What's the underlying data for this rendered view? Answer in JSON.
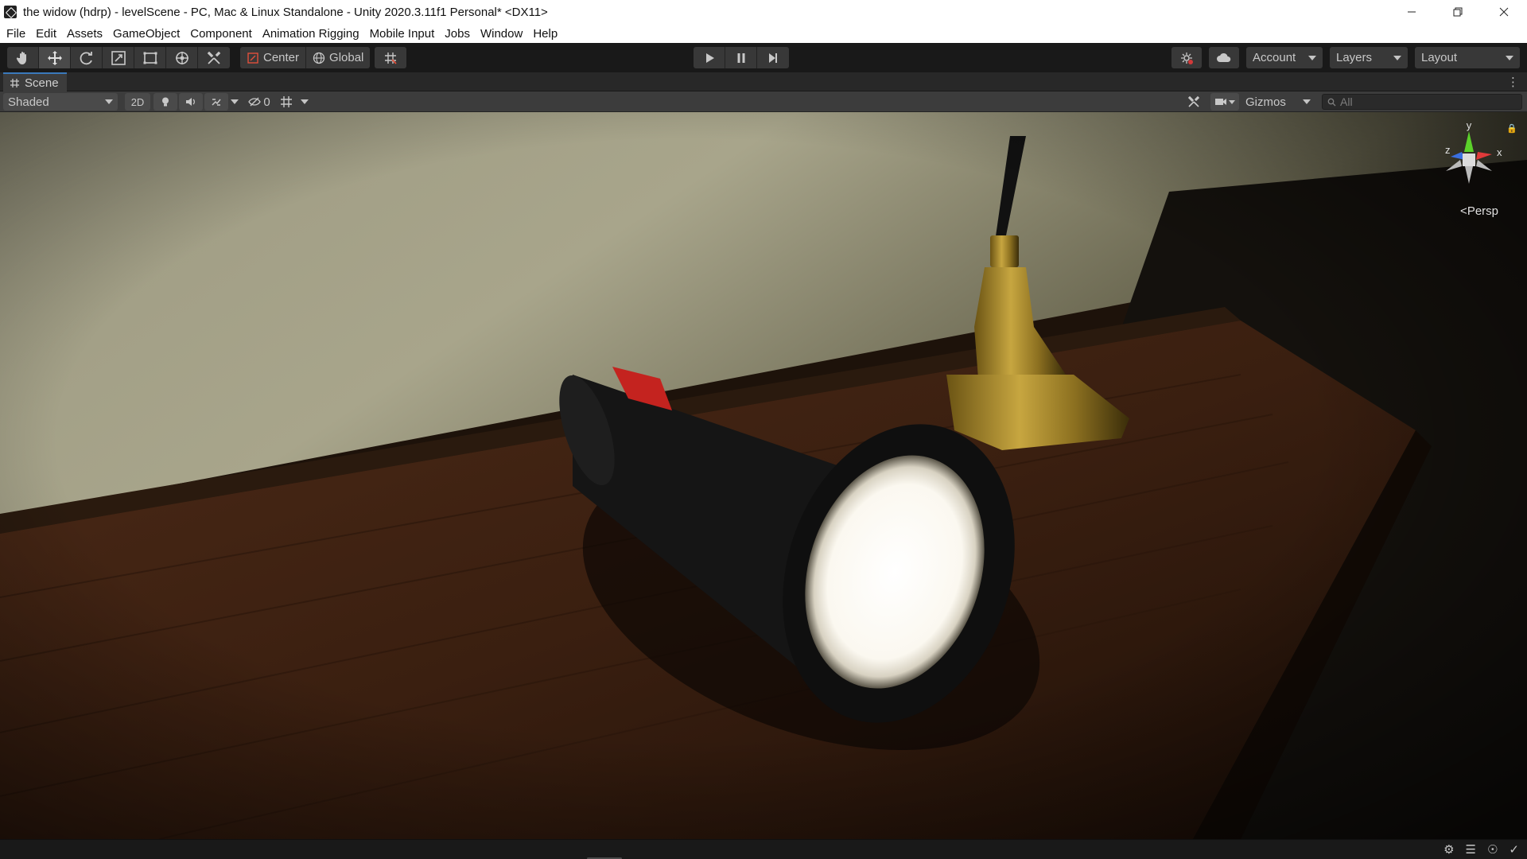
{
  "window": {
    "title": "the widow (hdrp) - levelScene - PC, Mac & Linux Standalone - Unity 2020.3.11f1 Personal* <DX11>",
    "minimize_icon": "minimize-icon",
    "maximize_icon": "restore-icon",
    "close_icon": "close-icon"
  },
  "menu": {
    "items": [
      "File",
      "Edit",
      "Assets",
      "GameObject",
      "Component",
      "Animation Rigging",
      "Mobile Input",
      "Jobs",
      "Window",
      "Help"
    ]
  },
  "toolbar": {
    "tools": [
      "hand-tool-icon",
      "move-tool-icon",
      "rotate-tool-icon",
      "scale-tool-icon",
      "rect-tool-icon",
      "transform-tool-icon",
      "custom-tool-icon"
    ],
    "active_tool_index": 1,
    "pivot_mode": "Center",
    "pivot_rotation": "Global",
    "snap_icon": "grid-snap-icon",
    "play_icon": "play-icon",
    "pause_icon": "pause-icon",
    "step_icon": "step-icon",
    "collab_icon": "collab-icon",
    "cloud_icon": "cloud-icon",
    "account_label": "Account",
    "layers_label": "Layers",
    "layout_label": "Layout"
  },
  "scene_tab": {
    "label": "Scene",
    "icon": "grid-icon"
  },
  "scene_toolbar": {
    "draw_mode": "Shaded",
    "mode_2d": "2D",
    "hidden_count": "0",
    "gizmos_label": "Gizmos",
    "search_placeholder": "All"
  },
  "viewport": {
    "projection": "Persp",
    "axes": {
      "y": "y",
      "x": "x",
      "z": "z"
    }
  },
  "colors": {
    "accent": "#3a79bb",
    "gizmo_x": "#e03a3a",
    "gizmo_y": "#5bd12a",
    "gizmo_z": "#3a6fe0"
  }
}
